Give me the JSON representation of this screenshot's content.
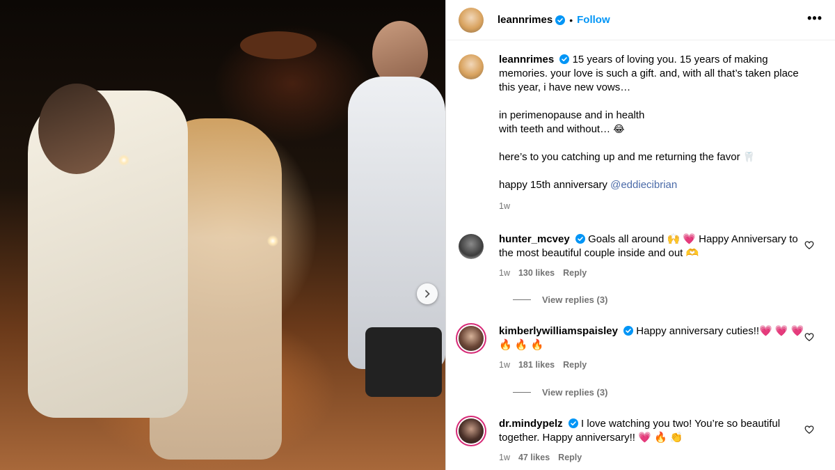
{
  "post": {
    "username": "leannrimes",
    "follow_label": "Follow",
    "more_label": "•••",
    "dot": "•"
  },
  "caption": {
    "username": "leannrimes",
    "line1": "15 years of loving you. 15 years of making memories. your love is such a gift. and, with all that’s taken place this year, i have new vows…",
    "line2a": "in perimenopause and in health",
    "line2b": "with teeth and without… ",
    "line2b_emoji": "😂",
    "line3": "here’s to you catching up and me returning the favor ",
    "line3_emoji": "🦷",
    "line4": "happy 15th anniversary ",
    "mention": "@eddiecibrian",
    "time": "1w"
  },
  "comments": [
    {
      "username": "hunter_mcvey",
      "text": "Goals all around 🙌 💗 Happy Anniversary to the most beautiful couple inside and out 🫶",
      "time": "1w",
      "likes": "130 likes",
      "reply": "Reply",
      "view_replies": "View replies (3)"
    },
    {
      "username": "kimberlywilliamspaisley",
      "text": "Happy anniversary cuties!!💗 💗 💗 🔥 🔥 🔥",
      "time": "1w",
      "likes": "181 likes",
      "reply": "Reply",
      "view_replies": "View replies (3)"
    },
    {
      "username": "dr.mindypelz",
      "text": "I love watching you two! You’re so beautiful together. Happy anniversary!! 💗 🔥 👏",
      "time": "1w",
      "likes": "47 likes",
      "reply": "Reply"
    }
  ],
  "colors": {
    "accent": "#0095f6",
    "verified": "#0095f6",
    "muted": "#737373",
    "mention": "#4a6aa8"
  },
  "icons": {
    "verified": "verified-badge-icon",
    "more": "more-options-icon",
    "heart": "heart-outline-icon",
    "next": "chevron-right-icon"
  }
}
